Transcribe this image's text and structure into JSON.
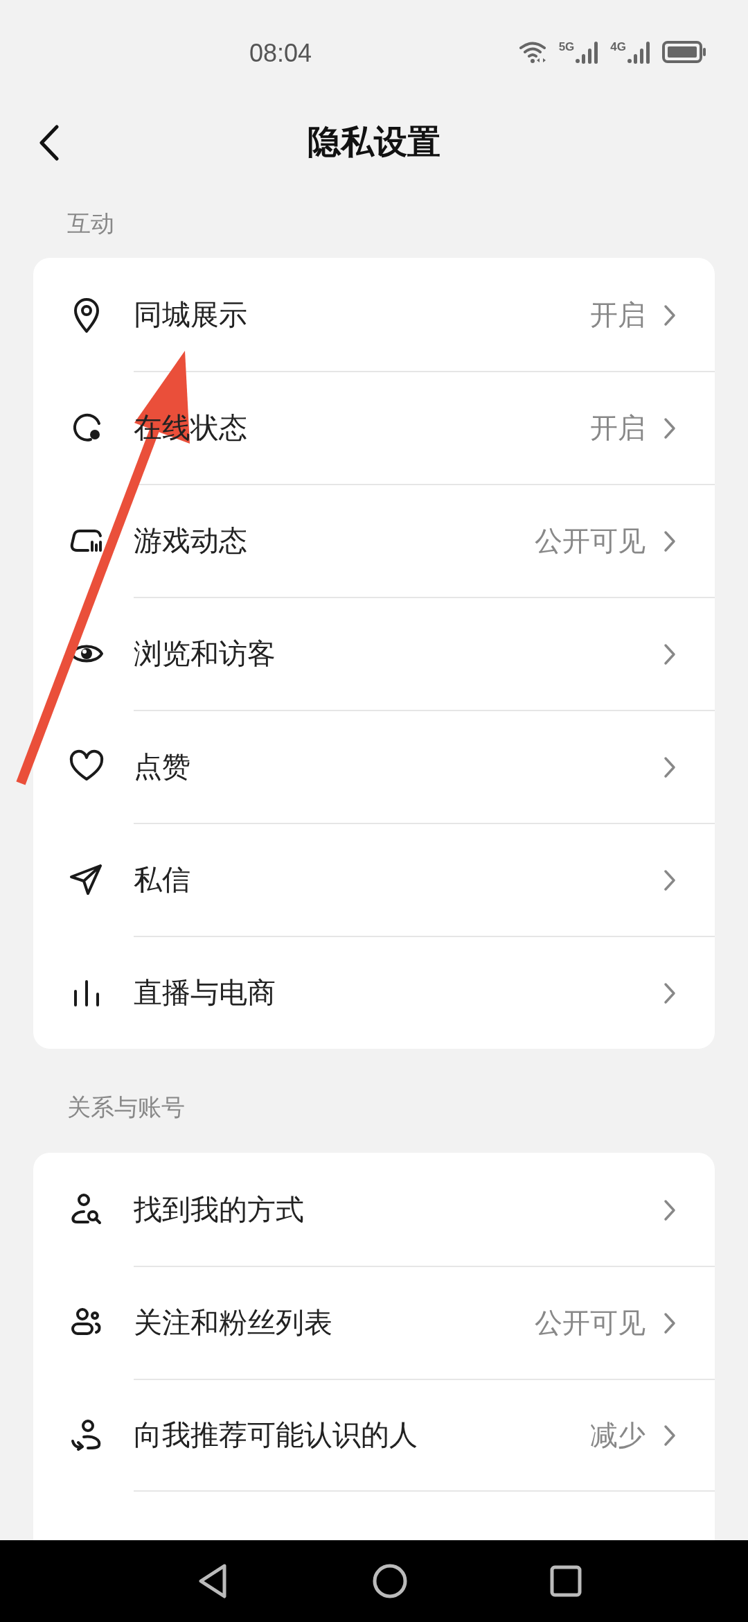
{
  "status_bar": {
    "time": "08:04",
    "network_labels": [
      "5G",
      "4G"
    ]
  },
  "header": {
    "title": "隐私设置"
  },
  "sections": [
    {
      "label": "互动",
      "items": [
        {
          "label": "同城展示",
          "value": "开启"
        },
        {
          "label": "在线状态",
          "value": "开启"
        },
        {
          "label": "游戏动态",
          "value": "公开可见"
        },
        {
          "label": "浏览和访客"
        },
        {
          "label": "点赞"
        },
        {
          "label": "私信"
        },
        {
          "label": "直播与电商"
        }
      ]
    },
    {
      "label": "关系与账号",
      "items": [
        {
          "label": "找到我的方式"
        },
        {
          "label": "关注和粉丝列表",
          "value": "公开可见"
        },
        {
          "label": "向我推荐可能认识的人",
          "value": "减少"
        }
      ]
    }
  ]
}
